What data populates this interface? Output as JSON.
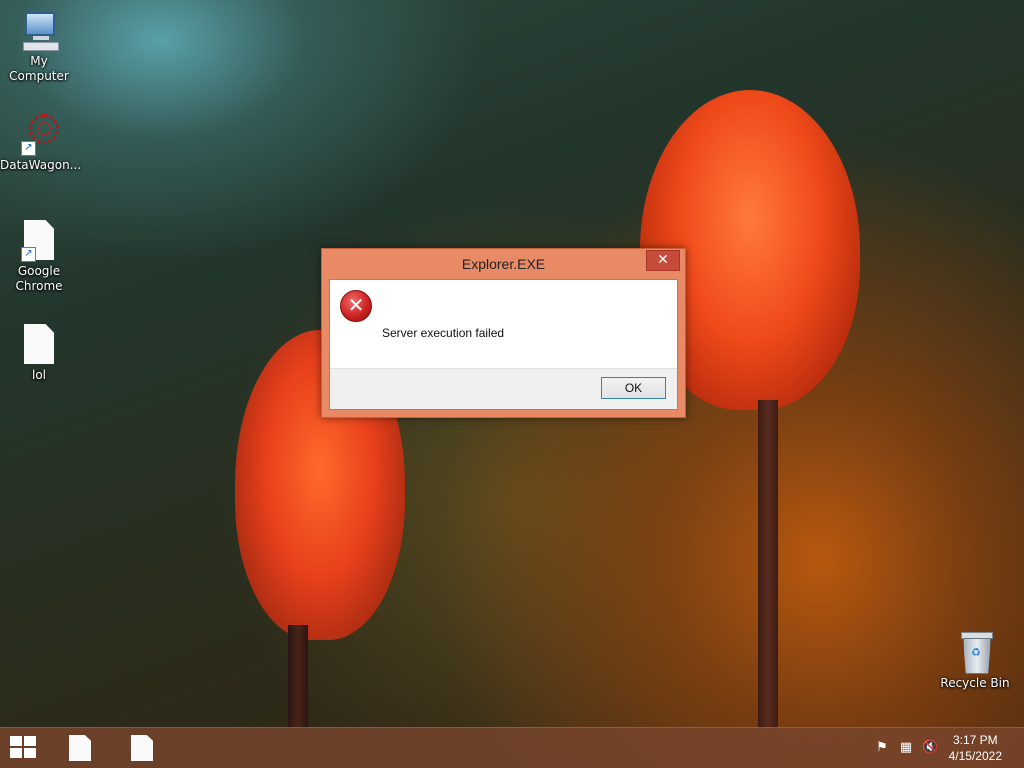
{
  "desktop": {
    "icons": [
      {
        "label": "My Computer",
        "icon": "computer-icon"
      },
      {
        "label": "DataWagon...",
        "icon": "datawagon-icon"
      },
      {
        "label": "Google Chrome",
        "icon": "file-icon"
      },
      {
        "label": "lol",
        "icon": "file-icon"
      }
    ],
    "recycle_bin": {
      "label": "Recycle Bin",
      "icon": "recycle-bin-icon"
    }
  },
  "dialog": {
    "title": "Explorer.EXE",
    "close_label": "✕",
    "error_glyph": "✕",
    "message": "Server execution failed",
    "ok_label": "OK"
  },
  "taskbar": {
    "items": [
      {
        "icon": "file-icon"
      },
      {
        "icon": "file-icon"
      }
    ],
    "tray": [
      "flag-icon",
      "network-icon",
      "speaker-muted-icon"
    ],
    "time": "3:17 PM",
    "date": "4/15/2022"
  },
  "colors": {
    "dialog_frame": "#e88a66",
    "close_button": "#c74b3a",
    "ok_border": "#3c7fb1"
  }
}
